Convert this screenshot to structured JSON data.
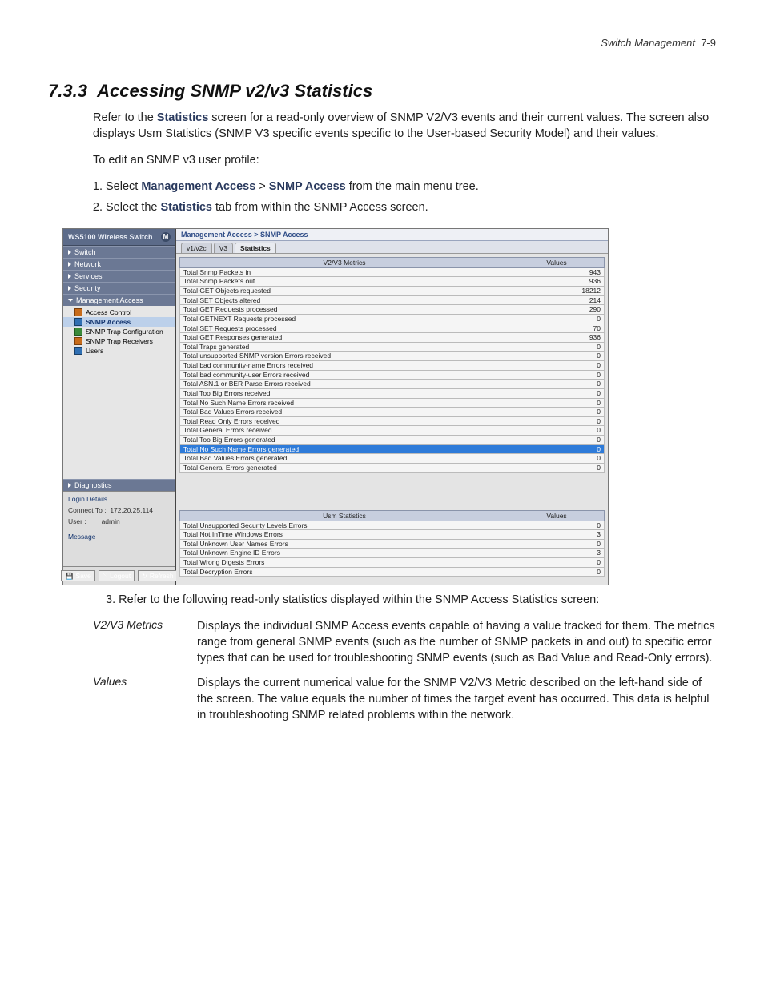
{
  "header": {
    "chapter": "Switch Management",
    "page": "7-9"
  },
  "section": {
    "number": "7.3.3",
    "title": "Accessing SNMP v2/v3 Statistics"
  },
  "intro1_pre": "Refer to the ",
  "intro1_bold": "Statistics",
  "intro1_post": " screen for a read-only overview of SNMP V2/V3 events and their current values. The screen also displays Usm Statistics (SNMP V3 specific events specific to the User-based Security Model) and their values.",
  "intro2": "To edit an SNMP v3 user profile:",
  "steps": {
    "s1_a": "Select ",
    "s1_b": "Management Access",
    "s1_c": " > ",
    "s1_d": "SNMP Access",
    "s1_e": " from the main menu tree.",
    "s2_a": "Select the ",
    "s2_b": "Statistics",
    "s2_c": " tab from within the SNMP Access screen."
  },
  "shot": {
    "brand": "WS5100 Wireless Switch",
    "nav": {
      "items": [
        "Switch",
        "Network",
        "Services",
        "Security",
        "Management Access"
      ],
      "subitems": [
        "Access Control",
        "SNMP Access",
        "SNMP Trap Configuration",
        "SNMP Trap Receivers",
        "Users"
      ],
      "diag": "Diagnostics"
    },
    "login": {
      "title": "Login Details",
      "connect_lbl": "Connect To :",
      "connect_val": "172.20.25.114",
      "user_lbl": "User :",
      "user_val": "admin",
      "msg": "Message"
    },
    "buttons": {
      "save": "Save",
      "logout": "Logout",
      "refresh": "Refresh"
    },
    "crumb": "Management Access > SNMP Access",
    "tabs": {
      "t1": "v1/v2c",
      "t2": "V3",
      "t3": "Statistics"
    },
    "table1": {
      "h1": "V2/V3 Metrics",
      "h2": "Values",
      "rows": [
        {
          "m": "Total Snmp Packets in",
          "v": "943"
        },
        {
          "m": "Total Snmp Packets out",
          "v": "936"
        },
        {
          "m": "Total GET Objects requested",
          "v": "18212"
        },
        {
          "m": "Total SET Objects altered",
          "v": "214"
        },
        {
          "m": "Total GET Requests processed",
          "v": "290"
        },
        {
          "m": "Total GETNEXT Requests processed",
          "v": "0"
        },
        {
          "m": "Total SET Requests processed",
          "v": "70"
        },
        {
          "m": "Total GET Responses generated",
          "v": "936"
        },
        {
          "m": "Total Traps generated",
          "v": "0"
        },
        {
          "m": "Total unsupported SNMP version Errors received",
          "v": "0"
        },
        {
          "m": "Total bad community-name Errors received",
          "v": "0"
        },
        {
          "m": "Total bad community-user Errors received",
          "v": "0"
        },
        {
          "m": "Total ASN.1 or BER Parse Errors received",
          "v": "0"
        },
        {
          "m": "Total Too Big Errors received",
          "v": "0"
        },
        {
          "m": "Total No Such Name Errors received",
          "v": "0"
        },
        {
          "m": "Total Bad Values Errors received",
          "v": "0"
        },
        {
          "m": "Total Read Only Errors received",
          "v": "0"
        },
        {
          "m": "Total General Errors received",
          "v": "0"
        },
        {
          "m": "Total Too Big Errors generated",
          "v": "0"
        },
        {
          "m": "Total No Such Name Errors generated",
          "v": "0",
          "hi": true
        },
        {
          "m": "Total Bad Values Errors generated",
          "v": "0"
        },
        {
          "m": "Total General Errors generated",
          "v": "0"
        }
      ]
    },
    "table2": {
      "h1": "Usm Statistics",
      "h2": "Values",
      "rows": [
        {
          "m": "Total Unsupported Security Levels Errors",
          "v": "0"
        },
        {
          "m": "Total Not InTime Windows Errors",
          "v": "3"
        },
        {
          "m": "Total Unknown User Names Errors",
          "v": "0"
        },
        {
          "m": "Total Unknown Engine ID Errors",
          "v": "3"
        },
        {
          "m": "Total Wrong Digests Errors",
          "v": "0"
        },
        {
          "m": "Total Decryption Errors",
          "v": "0"
        }
      ]
    }
  },
  "post_step3": "Refer to the following read-only statistics displayed within the SNMP Access Statistics screen:",
  "defs": {
    "d1t": "V2/V3 Metrics",
    "d1b": "Displays the individual SNMP Access events capable of having a value tracked for them. The metrics range from general SNMP events (such as the number of SNMP packets in and out) to specific error types that can be used for troubleshooting SNMP events (such as Bad Value and Read-Only errors).",
    "d2t": "Values",
    "d2b": "Displays the current numerical value for the SNMP V2/V3 Metric described on the left-hand side of the screen. The value equals the number of times the target event has occurred. This data is helpful in troubleshooting SNMP related problems within the network."
  }
}
